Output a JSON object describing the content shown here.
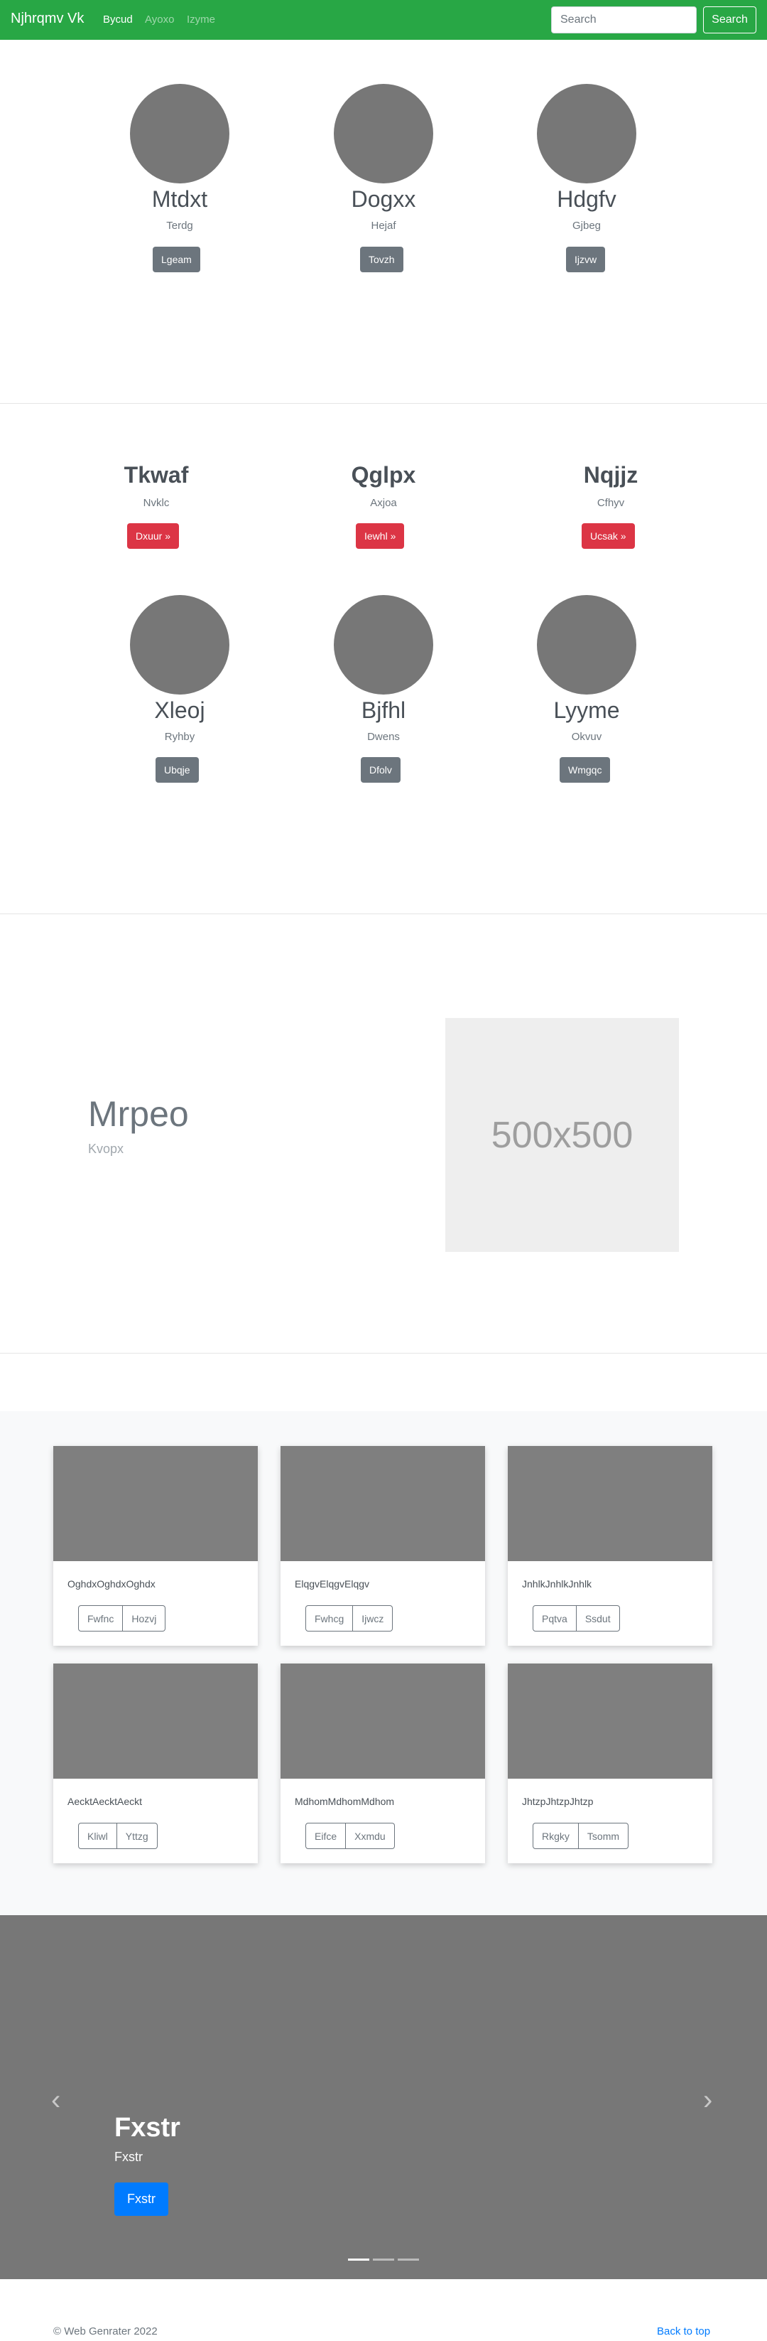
{
  "navbar": {
    "brand": "Njhrqmv Vk",
    "links": [
      "Bycud",
      "Ayoxo",
      "Izyme"
    ],
    "search_placeholder": "Search",
    "search_button": "Search"
  },
  "team_row_1": [
    {
      "name": "Mtdxt",
      "sub": "Terdg",
      "button": "Lgeam"
    },
    {
      "name": "Dogxx",
      "sub": "Hejaf",
      "button": "Tovzh"
    },
    {
      "name": "Hdgfv",
      "sub": "Gjbeg",
      "button": "Ijzvw"
    }
  ],
  "headings": [
    {
      "title": "Tkwaf",
      "sub": "Nvklc",
      "button": "Dxuur »"
    },
    {
      "title": "Qglpx",
      "sub": "Axjoa",
      "button": "Iewhl »"
    },
    {
      "title": "Nqjjz",
      "sub": "Cfhyv",
      "button": "Ucsak »"
    }
  ],
  "team_row_2": [
    {
      "name": "Xleoj",
      "sub": "Ryhby",
      "button": "Ubqje"
    },
    {
      "name": "Bjfhl",
      "sub": "Dwens",
      "button": "Dfolv"
    },
    {
      "name": "Lyyme",
      "sub": "Okvuv",
      "button": "Wmgqc"
    }
  ],
  "feature": {
    "title": "Mrpeo",
    "sub": "Kvopx",
    "placeholder": "500x500"
  },
  "cards": [
    {
      "text": "OghdxOghdxOghdx",
      "btn1": "Fwfnc",
      "btn2": "Hozvj"
    },
    {
      "text": "ElqgvElqgvElqgv",
      "btn1": "Fwhcg",
      "btn2": "Ijwcz"
    },
    {
      "text": "JnhlkJnhlkJnhlk",
      "btn1": "Pqtva",
      "btn2": "Ssdut"
    },
    {
      "text": "AecktAecktAeckt",
      "btn1": "Kliwl",
      "btn2": "Yttzg"
    },
    {
      "text": "MdhomMdhomMdhom",
      "btn1": "Eifce",
      "btn2": "Xxmdu"
    },
    {
      "text": "JhtzpJhtzpJhtzp",
      "btn1": "Rkgky",
      "btn2": "Tsomm"
    }
  ],
  "carousel": {
    "title": "Fxstr",
    "sub": "Fxstr",
    "button": "Fxstr",
    "prev_icon": "chevron-left-icon",
    "next_icon": "chevron-right-icon",
    "active_slide": 1,
    "slide_count": 3
  },
  "footer": {
    "copyright": "© Web Genrater 2022",
    "back_to_top": "Back to top"
  },
  "colors": {
    "navbar": "#28a745",
    "danger": "#dc3545",
    "primary": "#007bff",
    "secondary": "#6c757d"
  }
}
